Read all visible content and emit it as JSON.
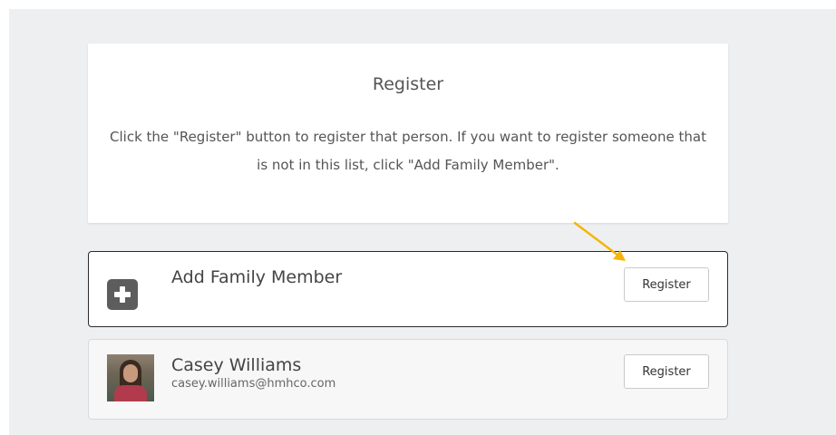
{
  "header": {
    "title": "Register",
    "instructions": "Click the \"Register\" button to register that person. If you want to register someone that is not in this list, click \"Add Family Member\"."
  },
  "add_row": {
    "icon": "plus-icon",
    "title": "Add Family Member",
    "button_label": "Register"
  },
  "person_row": {
    "name": "Casey Williams",
    "email": "casey.williams@hmhco.com",
    "button_label": "Register"
  },
  "colors": {
    "background": "#eeeff1",
    "annotation_arrow": "#f5b50a"
  }
}
